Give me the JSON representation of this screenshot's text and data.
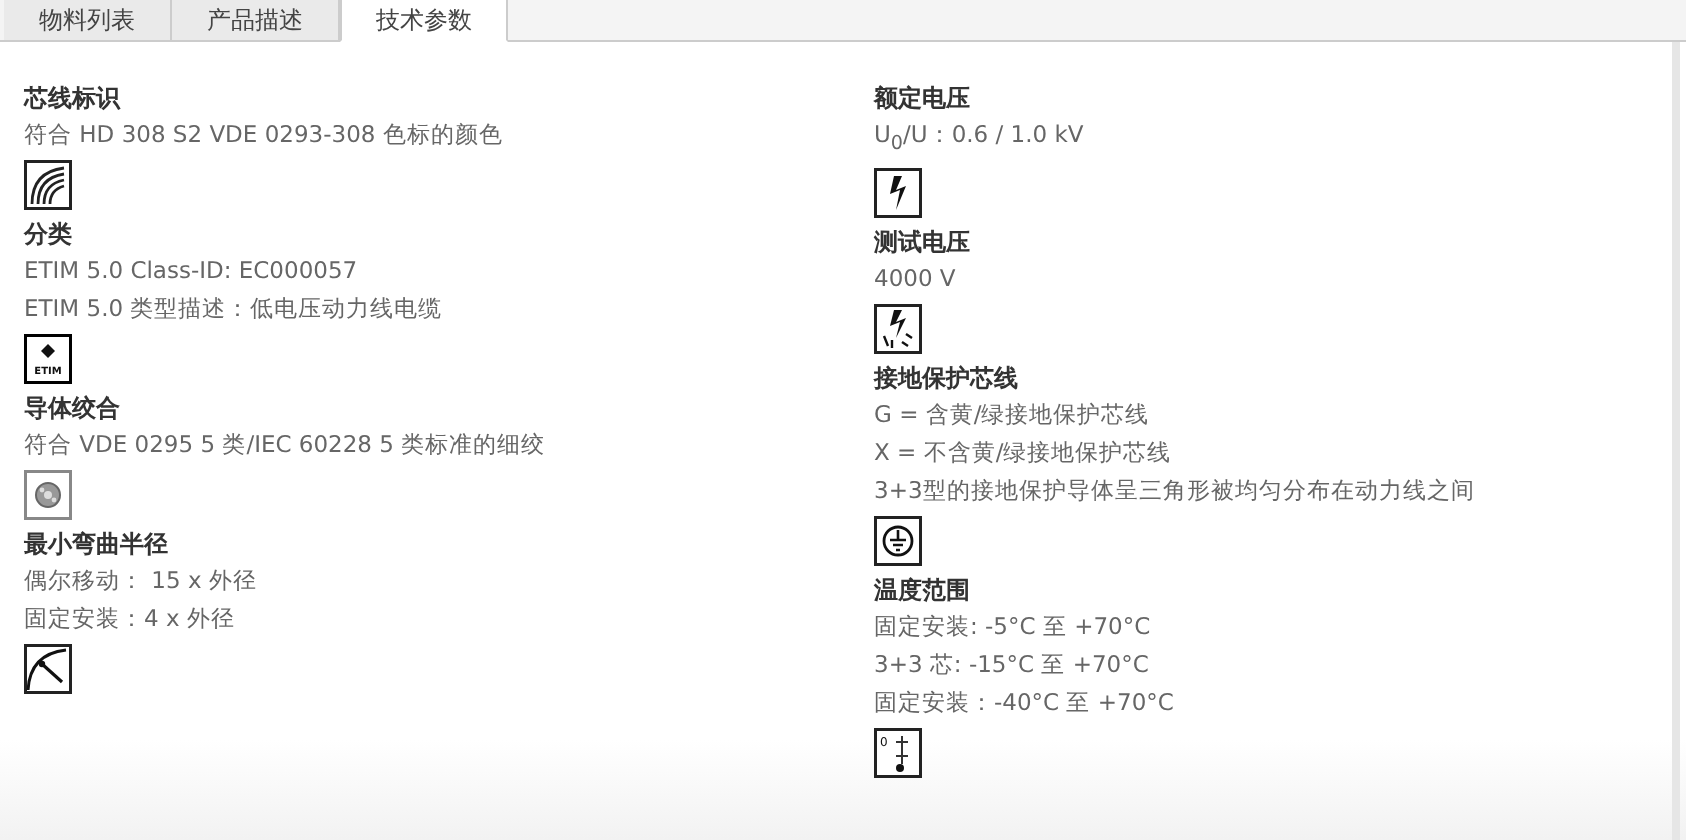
{
  "tabs": [
    {
      "label": "物料列表",
      "selected": false
    },
    {
      "label": "产品描述",
      "selected": false
    },
    {
      "label": "技术参数",
      "selected": true
    }
  ],
  "columns": [
    {
      "sections": [
        {
          "title": "芯线标识",
          "lines": [
            "符合 HD 308 S2 VDE 0293-308 色标的颜色"
          ],
          "kind": "cable-color"
        },
        {
          "title": "分类",
          "lines": [
            "ETIM 5.0 Class-ID: EC000057",
            "ETIM 5.0 类型描述：低电压动力线电缆"
          ],
          "kind": "etim",
          "icon_text": "ETIM"
        },
        {
          "title": "导体绞合",
          "lines": [
            "符合 VDE 0295 5 类/IEC 60228 5 类标准的细绞"
          ],
          "kind": "strand"
        },
        {
          "title": "最小弯曲半径",
          "lines": [
            "偶尔移动： 15 x 外径",
            "固定安装：4 x 外径"
          ],
          "kind": "bend"
        }
      ]
    },
    {
      "sections": [
        {
          "title": "额定电压",
          "lines": [
            "U$_{0}$/U：0.6 / 1.0 kV"
          ],
          "kind": "voltage"
        },
        {
          "title": "测试电压",
          "lines": [
            "4000 V"
          ],
          "kind": "test-voltage"
        },
        {
          "title": "接地保护芯线",
          "lines": [
            "G = 含黄/绿接地保护芯线",
            "X = 不含黄/绿接地保护芯线",
            "3+3型的接地保护导体呈三角形被均匀分布在动力线之间"
          ],
          "kind": "ground"
        },
        {
          "title": "温度范围",
          "lines": [
            "固定安装: -5°C 至 +70°C",
            "3+3 芯: -15°C 至 +70°C",
            "固定安装：-40°C 至 +70°C"
          ],
          "kind": "temperature",
          "icon_text": "0"
        }
      ]
    }
  ]
}
